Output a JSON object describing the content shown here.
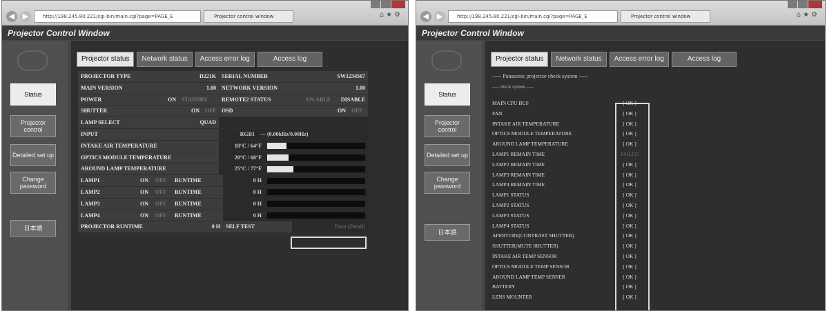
{
  "browser": {
    "left": {
      "address": "http://198.245.80.221/cgi-bin/main.cgi?page=PAGE_E",
      "tab": "Projector control window"
    },
    "right": {
      "address": "http://198.245.80.221/cgi-bin/main.cgi?page=PAGE_E",
      "tab": "Projector control window"
    }
  },
  "app": {
    "title": "Projector Control Window"
  },
  "sidebar": [
    {
      "id": "status",
      "label": "Status"
    },
    {
      "id": "projector-control",
      "label": "Projector control"
    },
    {
      "id": "detailed-setup",
      "label": "Detailed set up"
    },
    {
      "id": "change-password",
      "label": "Change password"
    },
    {
      "id": "japanese",
      "label": "日本語"
    }
  ],
  "tabs": [
    "Projector status",
    "Network status",
    "Access error log",
    "Access log"
  ],
  "status": {
    "projector_type": {
      "label": "PROJECTOR TYPE",
      "value": "D221K"
    },
    "serial_number": {
      "label": "SERIAL NUMBER",
      "value": "SW1234567"
    },
    "main_version": {
      "label": "MAIN VERSION",
      "value": "1.00"
    },
    "network_version": {
      "label": "NETWORK VERSION",
      "value": "1.00"
    },
    "power": {
      "label": "POWER",
      "on": "ON",
      "standby": "STANDBY"
    },
    "remote2_status": {
      "label": "REMOTE2 STATUS",
      "enable": "EN-ABLE",
      "disable": "DISABLE"
    },
    "shutter": {
      "label": "SHUTTER",
      "on": "ON",
      "off": "OFF"
    },
    "osd": {
      "label": "OSD",
      "on": "ON",
      "off": "OFF"
    },
    "lamp_select": {
      "label": "LAMP SELECT",
      "value": "QUAD"
    },
    "input": {
      "label": "INPUT",
      "value": "RGB1",
      "freq": "--- (0.00kHz/0.00Hz)"
    },
    "temps": [
      {
        "label": "INTAKE AIR TEMPERATURE",
        "value": "18°C / 64°F",
        "level": 0.2
      },
      {
        "label": "OPTICS MODULE TEMPERATURE",
        "value": "20°C / 68°F",
        "level": 0.22
      },
      {
        "label": "AROUND LAMP TEMPERATURE",
        "value": "25°C / 77°F",
        "level": 0.27
      }
    ],
    "lamps": [
      {
        "label": "LAMP1",
        "on": "ON",
        "off": "OFF",
        "runtime_label": "RUNTIME",
        "runtime": "0 H",
        "level": 0.0
      },
      {
        "label": "LAMP2",
        "on": "ON",
        "off": "OFF",
        "runtime_label": "RUNTIME",
        "runtime": "0 H",
        "level": 0.0
      },
      {
        "label": "LAMP3",
        "on": "ON",
        "off": "OFF",
        "runtime_label": "RUNTIME",
        "runtime": "0 H",
        "level": 0.0
      },
      {
        "label": "LAMP4",
        "on": "ON",
        "off": "OFF",
        "runtime_label": "RUNTIME",
        "runtime": "0 H",
        "level": 0.0
      }
    ],
    "projector_runtime": {
      "label": "PROJECTOR RUNTIME",
      "value": "0 H"
    },
    "self_test": {
      "label": "SELF TEST",
      "value": "Error (Detail)"
    }
  },
  "check": {
    "header": "----- Panasonic projector check system -----",
    "subheader": "---- check system ----",
    "items": [
      {
        "name": "MAIN CPU BUS",
        "result": "[ OK ]"
      },
      {
        "name": "FAN",
        "result": "[ OK ]"
      },
      {
        "name": "INTAKE AIR TEMPERATURE",
        "result": "[ OK ]"
      },
      {
        "name": "OPTICS MODULE TEMPERATURE",
        "result": "[ OK ]"
      },
      {
        "name": "AROUND LAMP TEMPERATURE",
        "result": "[ OK ]"
      },
      {
        "name": "LAMP1 REMAIN TIME",
        "result": "FAILED",
        "dim": true
      },
      {
        "name": "LAMP2 REMAIN TIME",
        "result": "[ OK ]"
      },
      {
        "name": "LAMP3 REMAIN TIME",
        "result": "[ OK ]"
      },
      {
        "name": "LAMP4 REMAIN TIME",
        "result": "[ OK ]"
      },
      {
        "name": "LAMP1 STATUS",
        "result": "[ OK ]"
      },
      {
        "name": "LAMP2 STATUS",
        "result": "[ OK ]"
      },
      {
        "name": "LAMP3 STATUS",
        "result": "[ OK ]"
      },
      {
        "name": "LAMP4 STATUS",
        "result": "[ OK ]"
      },
      {
        "name": "APERTURE(CONTRAST SHUTTER)",
        "result": "[ OK ]"
      },
      {
        "name": "SHUTTER(MUTE SHUTTER)",
        "result": "[ OK ]"
      },
      {
        "name": "INTAKE AIR TEMP SENSOR",
        "result": "[ OK ]"
      },
      {
        "name": "OPTICS MODULE TEMP SENSOR",
        "result": "[ OK ]"
      },
      {
        "name": "AROUND LAMP TEMP SENSER",
        "result": "[ OK ]"
      },
      {
        "name": "BATTERY",
        "result": "[ OK ]"
      },
      {
        "name": "LENS MOUNTER",
        "result": "[ OK ]"
      }
    ]
  }
}
